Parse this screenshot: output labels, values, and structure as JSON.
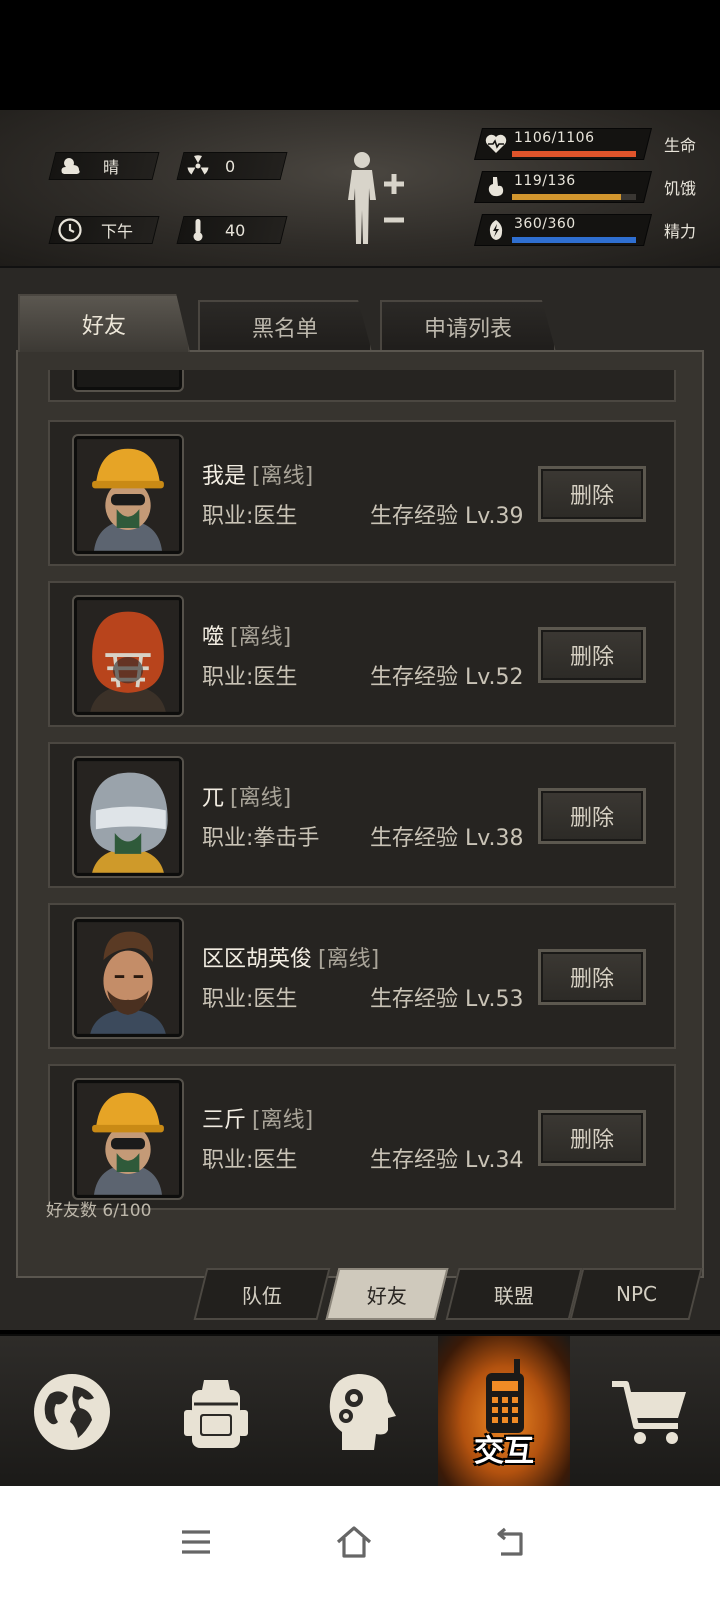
{
  "hud": {
    "weather": {
      "icon": "cloud-sun-icon",
      "label": "晴"
    },
    "radiation": {
      "icon": "radiation-icon",
      "value": "0"
    },
    "time": {
      "icon": "clock-icon",
      "label": "下午"
    },
    "temperature": {
      "icon": "thermometer-icon",
      "value": "40"
    },
    "stats": [
      {
        "icon": "heart-pulse-icon",
        "value": "1106/1106",
        "label": "生命",
        "fraction": 1.0,
        "color": "#e0542b"
      },
      {
        "icon": "stomach-icon",
        "value": "119/136",
        "label": "饥饿",
        "fraction": 0.875,
        "color": "#d2962e"
      },
      {
        "icon": "energy-icon",
        "value": "360/360",
        "label": "精力",
        "fraction": 1.0,
        "color": "#2f6fd1"
      }
    ]
  },
  "tabs": [
    "好友",
    "黑名单",
    "申请列表"
  ],
  "friends": [
    {
      "name": "我是",
      "status": "[离线]",
      "job": "职业:医生",
      "exp": "生存经验 Lv.39",
      "delete": "删除",
      "avatar": "hardhat-avatar"
    },
    {
      "name": "噬",
      "status": "[离线]",
      "job": "职业:医生",
      "exp": "生存经验 Lv.52",
      "delete": "删除",
      "avatar": "football-helmet-avatar"
    },
    {
      "name": "兀",
      "status": "[离线]",
      "job": "职业:拳击手",
      "exp": "生存经验 Lv.38",
      "delete": "删除",
      "avatar": "motorcycle-helmet-avatar"
    },
    {
      "name": "区区胡英俊",
      "status": "[离线]",
      "job": "职业:医生",
      "exp": "生存经验 Lv.53",
      "delete": "删除",
      "avatar": "bearded-man-avatar"
    },
    {
      "name": "三斤",
      "status": "[离线]",
      "job": "职业:医生",
      "exp": "生存经验 Lv.34",
      "delete": "删除",
      "avatar": "hardhat-avatar"
    }
  ],
  "friend_count": "好友数 6/100",
  "subtabs": [
    "队伍",
    "好友",
    "联盟",
    "NPC"
  ],
  "nav": {
    "items": [
      "globe-icon",
      "backpack-icon",
      "head-gears-icon",
      "radio-icon",
      "cart-icon"
    ],
    "active_label": "交互"
  },
  "system_nav": [
    "menu-icon",
    "home-icon",
    "back-icon"
  ]
}
